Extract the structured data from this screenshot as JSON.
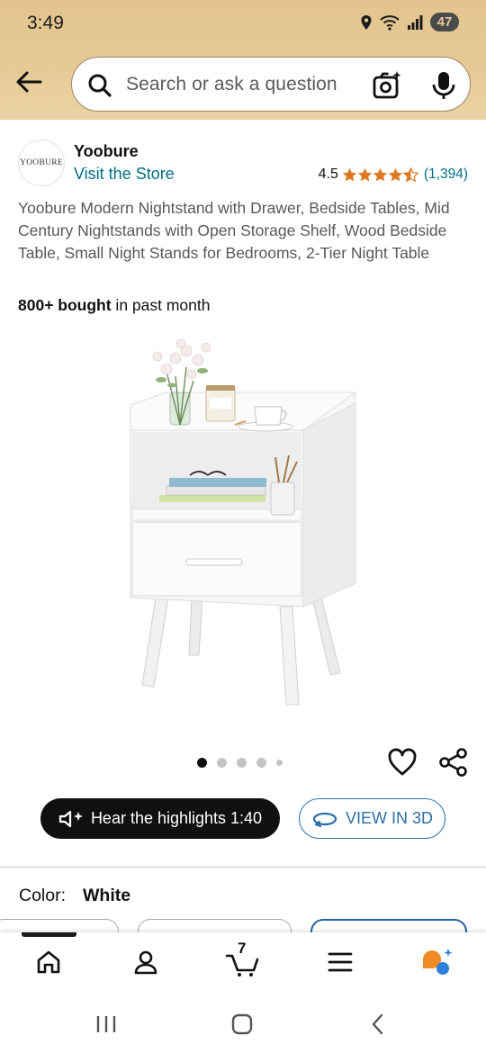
{
  "status_bar": {
    "time": "3:49",
    "battery": "47"
  },
  "search": {
    "placeholder": "Search or ask a question"
  },
  "store": {
    "logo_text": "YOOBURE",
    "brand": "Yoobure",
    "visit_label": "Visit the Store"
  },
  "rating": {
    "value": "4.5",
    "stars": 4.5,
    "count": "(1,394)"
  },
  "product": {
    "title": "Yoobure Modern Nightstand with Drawer, Bedside Tables, Mid Century Nightstands with Open Storage Shelf, Wood Bedside Table, Small Night Stands for Bedrooms, 2-Tier Night Table",
    "bought_bold": "800+ bought",
    "bought_rest": " in past month",
    "image_icon": "white-nightstand-product-photo"
  },
  "carousel": {
    "count": 5,
    "active_index": 0
  },
  "actions": {
    "hear_label": "Hear the highlights 1:40",
    "view3d_label": "VIEW IN 3D"
  },
  "variant": {
    "label": "Color:",
    "value": "White"
  },
  "bottom_nav": {
    "cart_count": "7",
    "items": [
      "home-icon",
      "account-icon",
      "cart-icon",
      "menu-icon",
      "rufus-icon"
    ]
  },
  "colors": {
    "header": "#e6c995",
    "link": "#007185",
    "star": "#de7921",
    "accent_3d": "#2a6fa8",
    "rufus_orange": "#f08a24",
    "rufus_blue": "#2d7fd8"
  }
}
